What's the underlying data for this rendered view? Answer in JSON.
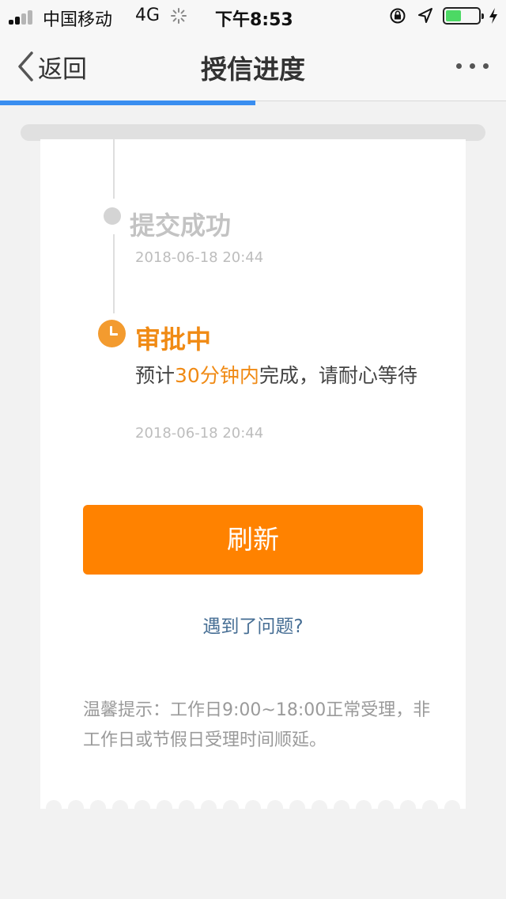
{
  "status_bar": {
    "carrier": "中国移动",
    "network": "4G",
    "time": "下午8:53",
    "battery_level": 0.45
  },
  "nav": {
    "back_label": "返回",
    "title": "授信进度",
    "load_progress": 0.505
  },
  "steps": [
    {
      "title": "提交成功",
      "time": "2018-06-18 20:44",
      "state": "done"
    },
    {
      "title": "审批中",
      "desc_before": "预计",
      "desc_highlight": "30分钟内",
      "desc_after": "完成，请耐心等待",
      "time": "2018-06-18 20:44",
      "state": "in-progress"
    }
  ],
  "refresh_label": "刷新",
  "help_link": "遇到了问题?",
  "tip": "温馨提示：工作日9:00~18:00正常受理，非工作日或节假日受理时间顺延。",
  "colors": {
    "accent": "#ff8200",
    "highlight": "#f08a14",
    "link": "#466e94",
    "progress": "#3a8ef0"
  }
}
